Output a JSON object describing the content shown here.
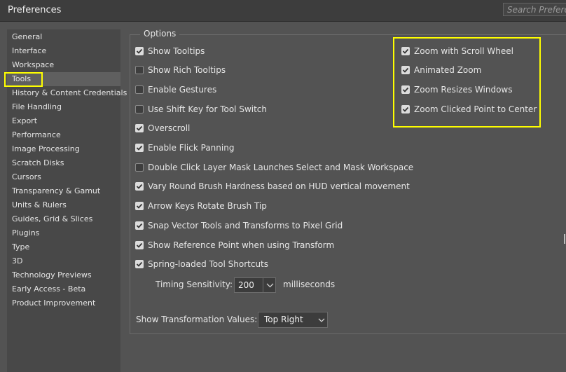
{
  "window": {
    "title": "Preferences",
    "search_placeholder": "Search Preferences"
  },
  "sidebar": {
    "items": [
      {
        "label": "General"
      },
      {
        "label": "Interface"
      },
      {
        "label": "Workspace"
      },
      {
        "label": "Tools",
        "selected": true
      },
      {
        "label": "History & Content Credentials"
      },
      {
        "label": "File Handling"
      },
      {
        "label": "Export"
      },
      {
        "label": "Performance"
      },
      {
        "label": "Image Processing"
      },
      {
        "label": "Scratch Disks"
      },
      {
        "label": "Cursors"
      },
      {
        "label": "Transparency & Gamut"
      },
      {
        "label": "Units & Rulers"
      },
      {
        "label": "Guides, Grid & Slices"
      },
      {
        "label": "Plugins"
      },
      {
        "label": "Type"
      },
      {
        "label": "3D"
      },
      {
        "label": "Technology Previews"
      },
      {
        "label": "Early Access - Beta"
      },
      {
        "label": "Product Improvement"
      }
    ]
  },
  "options": {
    "legend": "Options",
    "left_column": [
      {
        "label": "Show Tooltips",
        "checked": true
      },
      {
        "label": "Show Rich Tooltips",
        "checked": false
      },
      {
        "label": "Enable Gestures",
        "checked": false
      },
      {
        "label": "Use Shift Key for Tool Switch",
        "checked": false
      },
      {
        "label": "Overscroll",
        "checked": true
      },
      {
        "label": "Enable Flick Panning",
        "checked": true
      },
      {
        "label": "Double Click Layer Mask Launches Select and Mask Workspace",
        "checked": false
      },
      {
        "label": "Vary Round Brush Hardness based on HUD vertical movement",
        "checked": true
      },
      {
        "label": "Arrow Keys Rotate Brush Tip",
        "checked": true
      },
      {
        "label": "Snap Vector Tools and Transforms to Pixel Grid",
        "checked": true
      },
      {
        "label": "Show Reference Point when using Transform",
        "checked": true
      },
      {
        "label": "Spring-loaded Tool Shortcuts",
        "checked": true
      }
    ],
    "right_column": [
      {
        "label": "Zoom with Scroll Wheel",
        "checked": true
      },
      {
        "label": "Animated Zoom",
        "checked": true
      },
      {
        "label": "Zoom Resizes Windows",
        "checked": true
      },
      {
        "label": "Zoom Clicked Point to Center",
        "checked": true
      }
    ],
    "timing": {
      "label": "Timing Sensitivity:",
      "value": "200",
      "unit": "milliseconds"
    },
    "transformation": {
      "label": "Show Transformation Values:",
      "value": "Top Right"
    }
  },
  "colors": {
    "highlight": "#ffff00",
    "background": "#535353",
    "sidebar": "#484848"
  }
}
